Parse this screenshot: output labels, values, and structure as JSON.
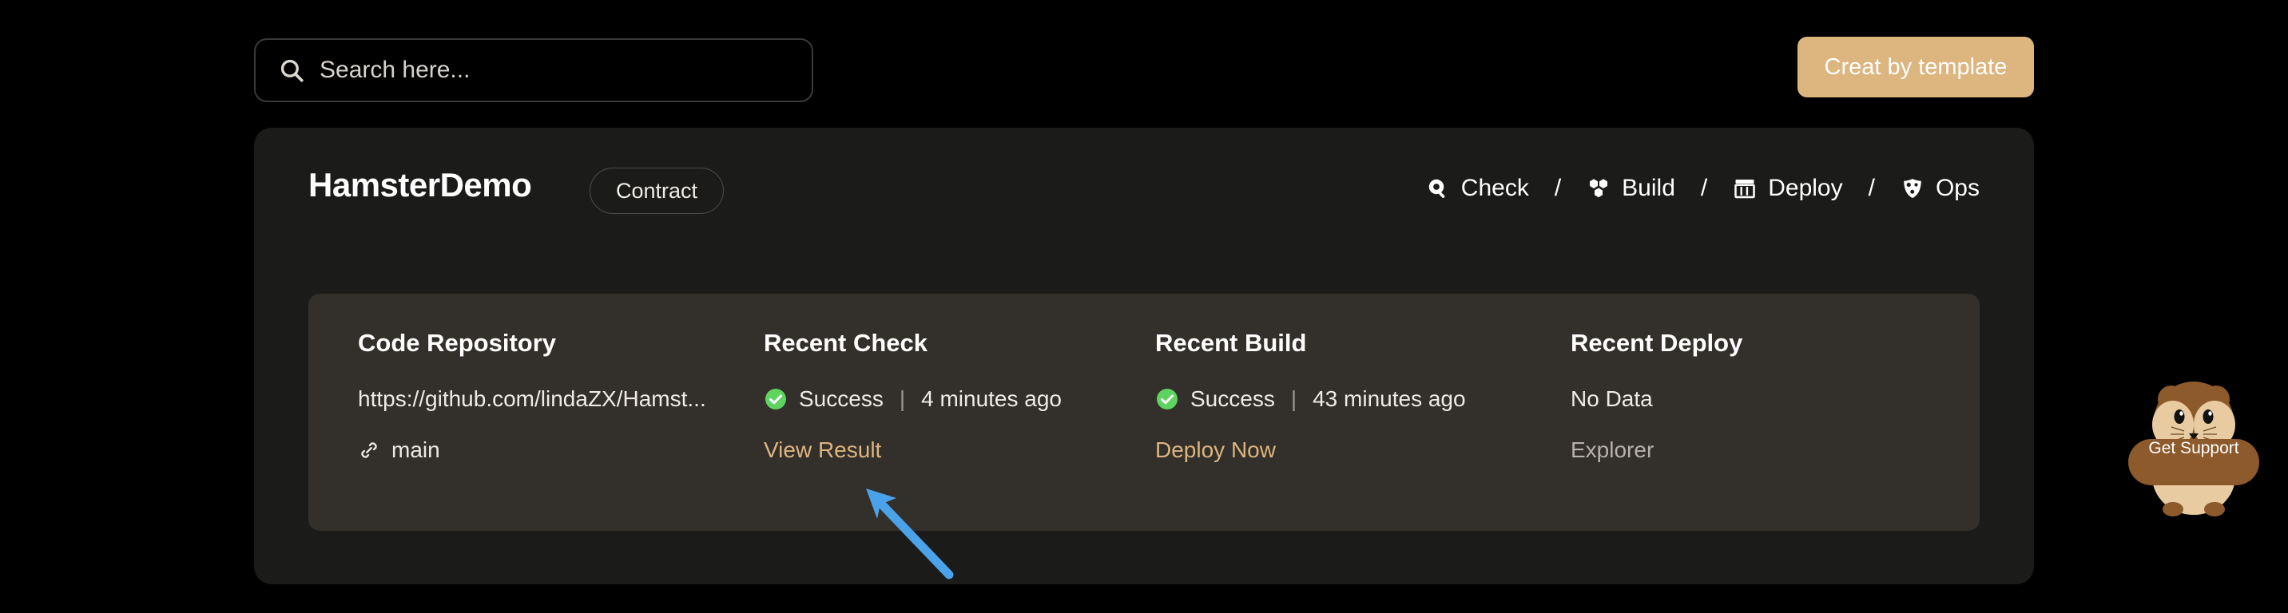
{
  "theme": {
    "page_bg": "#000000",
    "panel_bg": "#1b1b1a",
    "card_bg": "#332f2b",
    "accent": "#ddb57f",
    "success": "#5fd35f",
    "muted_text": "#b6b1ab",
    "arrow_color": "#4aa3e8"
  },
  "topbar": {
    "search": {
      "placeholder": "Search here...",
      "value": "",
      "icon": "search-icon"
    },
    "create_button": {
      "label": "Creat by template"
    }
  },
  "panel": {
    "project_title": "HamsterDemo",
    "badge": "Contract",
    "nav": {
      "separator": "/",
      "items": [
        {
          "label": "Check",
          "icon": "magnifier-icon"
        },
        {
          "label": "Build",
          "icon": "cubes-icon"
        },
        {
          "label": "Deploy",
          "icon": "server-rack-icon"
        },
        {
          "label": "Ops",
          "icon": "shield-nodes-icon"
        }
      ]
    },
    "cards": [
      {
        "title": "Code Repository",
        "value": "https://github.com/lindaZX/Hamst...",
        "branch_icon": "link-icon",
        "branch": "main"
      },
      {
        "title": "Recent Check",
        "status_icon": "success-check-icon",
        "status": "Success",
        "separator": "|",
        "timestamp": "4 minutes ago",
        "action": "View Result",
        "action_disabled": false
      },
      {
        "title": "Recent Build",
        "status_icon": "success-check-icon",
        "status": "Success",
        "separator": "|",
        "timestamp": "43 minutes ago",
        "action": "Deploy Now",
        "action_disabled": false
      },
      {
        "title": "Recent Deploy",
        "value": "No Data",
        "action": "Explorer",
        "action_disabled": true
      }
    ]
  },
  "support_widget": {
    "label": "Get Support",
    "icon": "hamster-mascot-icon"
  },
  "annotation": {
    "type": "arrow",
    "points_to": "View Result"
  }
}
